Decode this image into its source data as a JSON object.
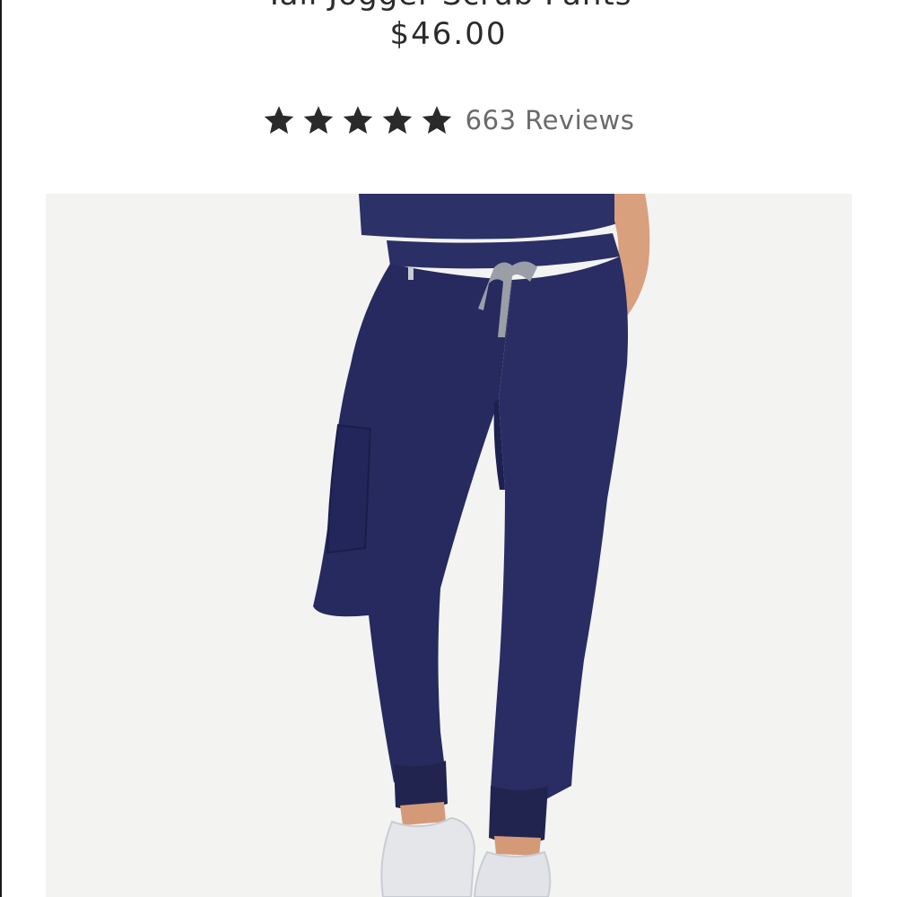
{
  "product": {
    "title": "Tall Jogger Scrub Pants",
    "price": "$46.00",
    "rating": {
      "stars": 5,
      "max": 5
    },
    "reviews_label": "663 Reviews"
  },
  "icons": {
    "rating_star": "star-icon"
  },
  "colors": {
    "text": "#2b2b2b",
    "review_text": "#6a6a6a",
    "star": "#2a2a2a",
    "image_background": "#f3f3f2",
    "pants_navy": "#262a5e",
    "drawstring": "#9a9ea6",
    "sneaker": "#e4e6ea"
  }
}
